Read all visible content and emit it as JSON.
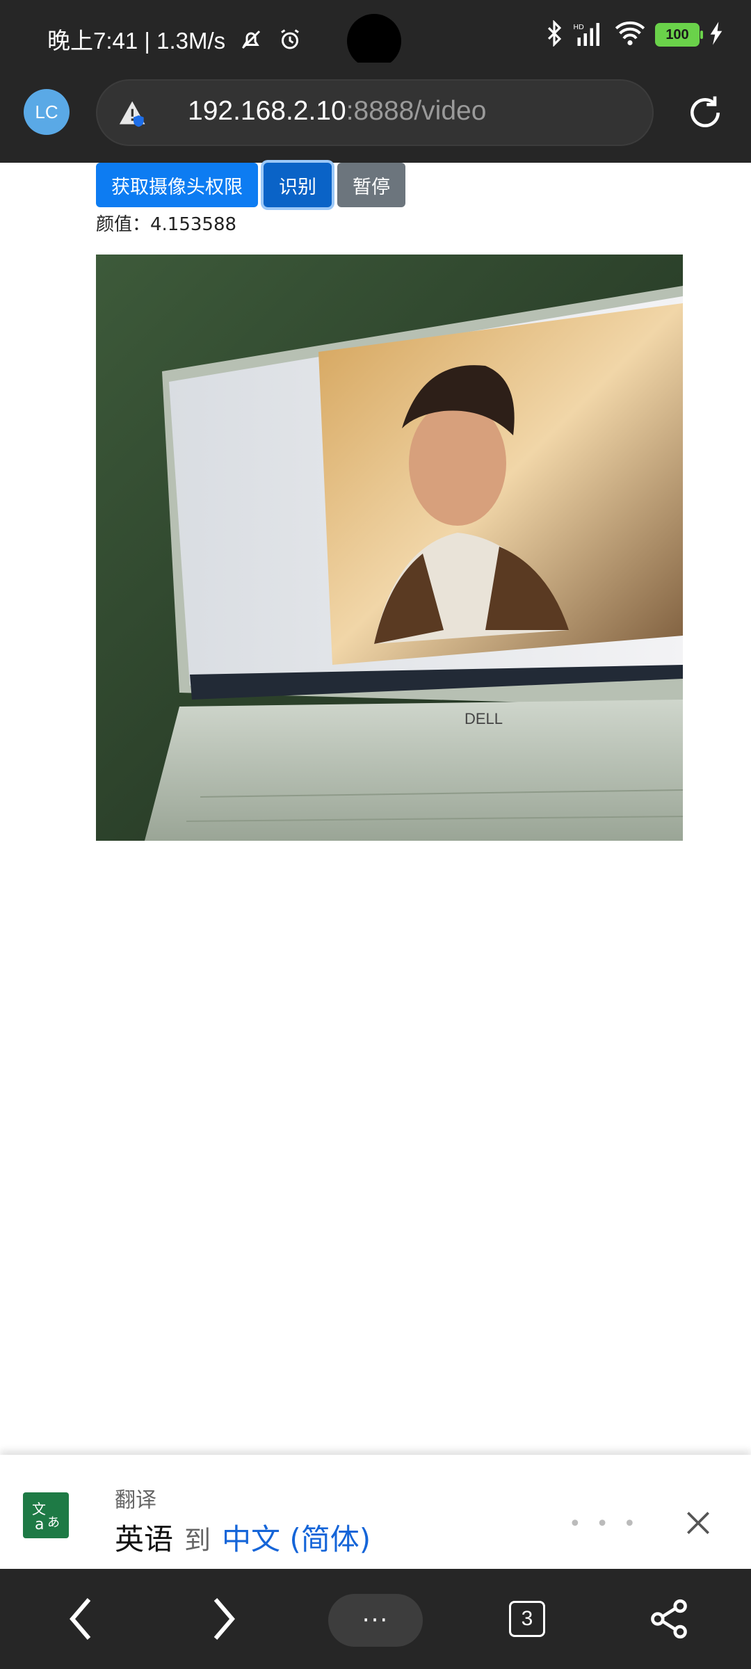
{
  "status_bar": {
    "time_speed": "晚上7:41 | 1.3M/s",
    "battery": "100",
    "icons": [
      "mute-icon",
      "alarm-icon",
      "bluetooth-icon",
      "signal-icon",
      "wifi-icon",
      "battery-icon",
      "charging-icon"
    ]
  },
  "browser": {
    "avatar": "LC",
    "url_host": "192.168.2.10",
    "url_path": ":8888/video"
  },
  "page": {
    "buttons": {
      "camera": "获取摄像头权限",
      "recognize": "识别",
      "pause": "暂停"
    },
    "score_text": "颜值：4.153588"
  },
  "translate": {
    "title": "翻译",
    "source_lang": "英语",
    "to": "到",
    "target_lang": "中文 (简体)"
  },
  "nav": {
    "tab_count": "3",
    "menu": "···"
  },
  "colors": {
    "primary": "#0d7cf2",
    "secondary": "#6c757d",
    "browser_chrome": "#262626",
    "link": "#1565d8"
  }
}
